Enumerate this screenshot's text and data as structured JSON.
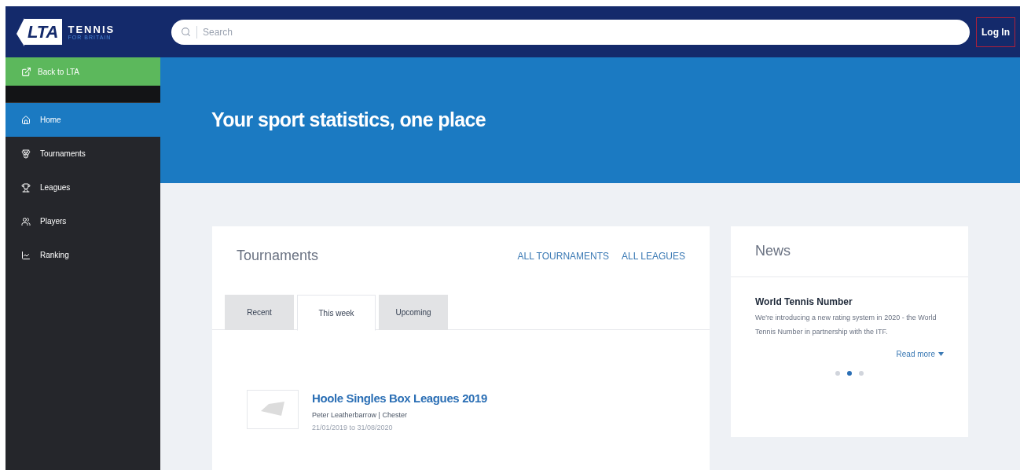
{
  "header": {
    "logo": {
      "mark": "LTA",
      "name": "TENNIS",
      "tagline": "FOR BRITAIN"
    },
    "search": {
      "placeholder": "Search"
    },
    "login": "Log In"
  },
  "sidebar": {
    "back_link": "Back to LTA",
    "items": [
      {
        "label": "Home",
        "selected": true
      },
      {
        "label": "Tournaments",
        "selected": false
      },
      {
        "label": "Leagues",
        "selected": false
      },
      {
        "label": "Players",
        "selected": false
      },
      {
        "label": "Ranking",
        "selected": false
      }
    ]
  },
  "banner": {
    "title": "Your sport statistics, one place"
  },
  "tournaments": {
    "title": "Tournaments",
    "links": [
      "ALL TOURNAMENTS",
      "ALL LEAGUES"
    ],
    "tabs": [
      {
        "label": "Recent",
        "selected": false
      },
      {
        "label": "This week",
        "selected": true
      },
      {
        "label": "Upcoming",
        "selected": false
      }
    ],
    "items": [
      {
        "name": "Hoole Singles Box Leagues 2019",
        "organiser": "Peter Leatherbarrow | Chester",
        "dates": "21/01/2019 to 31/08/2020"
      }
    ]
  },
  "news": {
    "title": "News",
    "article": {
      "headline": "World Tennis Number",
      "body": "We're introducing a new rating system in 2020 - the World Tennis Number in partnership with the ITF."
    },
    "read_more": "Read more",
    "dots": [
      {
        "selected": false
      },
      {
        "selected": true
      },
      {
        "selected": false
      }
    ]
  }
}
